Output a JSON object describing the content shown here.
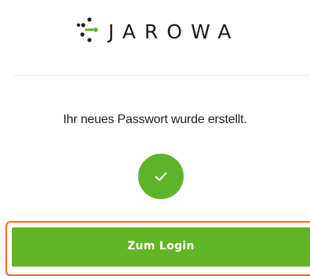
{
  "header": {
    "brand_name": "JAROWA",
    "logo_icon": "jarowa-dots-logo",
    "brand_color": "#5fb32a"
  },
  "content": {
    "message": "Ihr neues Passwort wurde erstellt.",
    "status_icon": "check-icon",
    "status_color": "#5fb32a"
  },
  "actions": {
    "login_label": "Zum Login",
    "login_color": "#62b523",
    "focus_outline_color": "#f06a22"
  }
}
